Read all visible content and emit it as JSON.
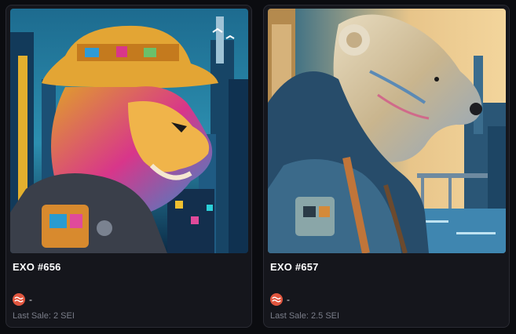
{
  "cards": [
    {
      "name": "EXO #656",
      "price": "-",
      "price_icon": "sei-token-icon",
      "last_sale": "Last Sale: 2 SEI",
      "image": "lion-in-hat-cityscape-art"
    },
    {
      "name": "EXO #657",
      "price": "-",
      "price_icon": "sei-token-icon",
      "last_sale": "Last Sale: 2.5 SEI",
      "image": "bear-in-hoodie-cityscape-art"
    }
  ],
  "colors": {
    "background": "#0b0c10",
    "card": "#15161c",
    "card_border": "#2a2b33",
    "sei_token": "#e0563f",
    "muted_text": "#7a7d89"
  }
}
